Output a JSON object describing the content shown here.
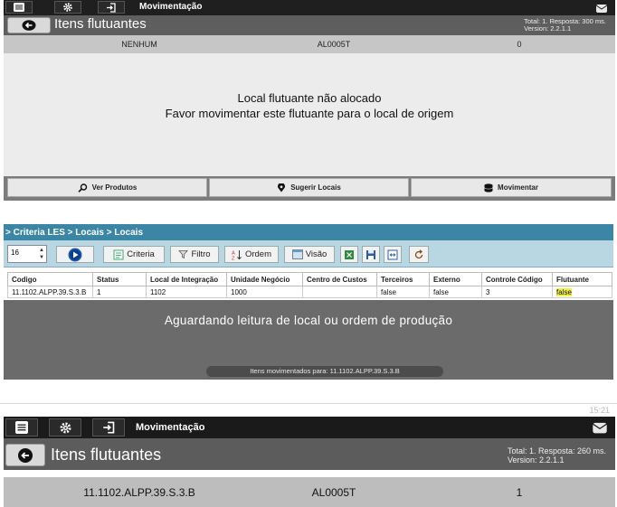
{
  "colors": {
    "topbar": "#1f1f1f",
    "title_row": "#5e5e5e",
    "info_row": "#c6c6c6",
    "crumb": "#3a86a4",
    "toolbar": "#b8d7e2",
    "wait_area": "#6b6b6b",
    "highlight": "#f4f04a"
  },
  "top_panel": {
    "menu_title": "Movimentação",
    "page_title": "Itens flutuantes",
    "stats_total": "Total: 1. Resposta: 300 ms.",
    "stats_version": "Version: 2.2.1.1",
    "row": [
      "NENHUM",
      "AL0005T",
      "0"
    ],
    "message_line1": "Local flutuante não alocado",
    "message_line2": "Favor movimentar este flutuante para o local de origem",
    "actions": {
      "ver_produtos": "Ver Produtos",
      "sugerir_locais": "Sugerir Locais",
      "movimentar": "Movimentar"
    }
  },
  "middle_panel": {
    "breadcrumb": "> Criteria LES > Locais > Locais",
    "page_size": "16",
    "toolbar": {
      "criteria": "Criteria",
      "filtro": "Filtro",
      "ordem": "Ordem",
      "visao": "Visão"
    },
    "columns": [
      "Codigo",
      "Status",
      "Local de Integração",
      "Unidade Negócio",
      "Centro de Custos",
      "Terceiros",
      "Externo",
      "Controle Código",
      "Flutuante"
    ],
    "rows": [
      [
        "11.1102.ALPP.39.S.3.B",
        "1",
        "1102",
        "1000",
        "",
        "false",
        "false",
        "3",
        "false"
      ]
    ],
    "waiting_message": "Aguardando leitura de local ou ordem de produção",
    "toast": "Itens movimentados para: 11.1102.ALPP.39.S.3.B"
  },
  "bottom_panel": {
    "clock": "15:21",
    "menu_title": "Movimentação",
    "page_title": "Itens flutuantes",
    "stats_total": "Total: 1. Resposta: 260 ms.",
    "stats_version": "Version: 2.2.1.1",
    "row": [
      "11.1102.ALPP.39.S.3.B",
      "AL0005T",
      "1"
    ]
  }
}
